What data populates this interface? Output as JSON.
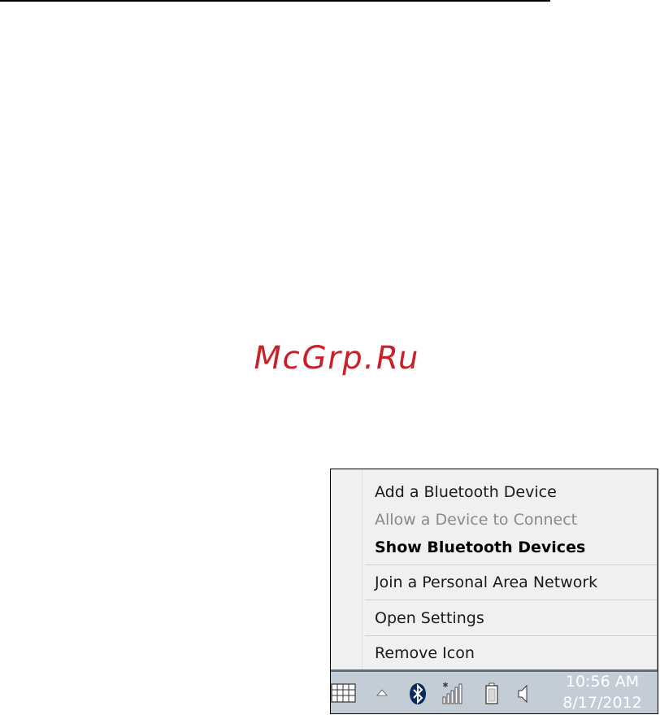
{
  "watermark": {
    "text": "McGrp.Ru"
  },
  "context_menu": {
    "items": [
      {
        "label": "Add a Bluetooth Device",
        "state": "enabled"
      },
      {
        "label": "Allow a Device to Connect",
        "state": "disabled"
      },
      {
        "label": "Show Bluetooth Devices",
        "state": "default"
      },
      {
        "label": "Join a Personal Area Network",
        "state": "enabled"
      },
      {
        "label": "Open Settings",
        "state": "enabled"
      },
      {
        "label": "Remove Icon",
        "state": "enabled"
      }
    ]
  },
  "taskbar": {
    "icons": [
      "touch-keyboard-icon",
      "show-hidden-icons-arrow-icon",
      "bluetooth-icon",
      "network-signal-icon",
      "battery-icon",
      "speaker-volume-icon"
    ],
    "clock": {
      "time": "10:56 AM",
      "date": "8/17/2012"
    }
  },
  "colors": {
    "watermark": "#c9202a",
    "menu_background": "#f0f0f0",
    "menu_disabled_text": "#8a8a8a",
    "taskbar_background": "#c4ccd6",
    "bluetooth_badge": "#0b2a5a"
  }
}
